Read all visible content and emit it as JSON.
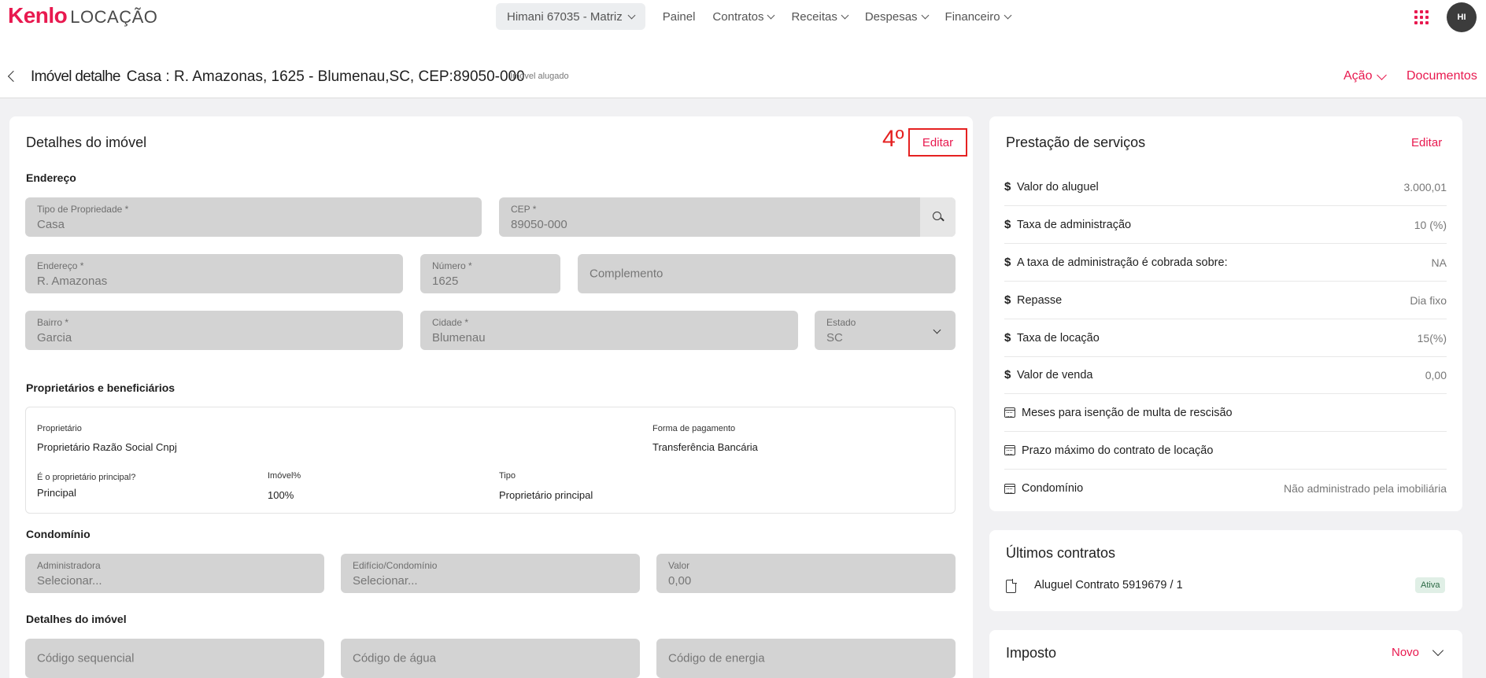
{
  "nav": {
    "brand": "Kenlo",
    "product": "LOCAÇÃO",
    "branch": "Himani 67035 - Matriz",
    "items": [
      "Painel",
      "Contratos",
      "Receitas",
      "Despesas",
      "Financeiro"
    ],
    "avatar_initials": "HI"
  },
  "header": {
    "title_prefix": "Imóvel detalhe",
    "title_address": "Casa : R. Amazonas, 1625 - Blumenau,SC, CEP:89050-000",
    "badge": "Imóvel alugado",
    "action": "Ação",
    "documents": "Documentos"
  },
  "details": {
    "title": "Detalhes do imóvel",
    "step_marker": "4º",
    "edit": "Editar",
    "address_section": "Endereço",
    "tipo": {
      "label": "Tipo de Propriedade *",
      "value": "Casa"
    },
    "cep": {
      "label": "CEP *",
      "value": "89050-000"
    },
    "endereco": {
      "label": "Endereço *",
      "value": "R. Amazonas"
    },
    "numero": {
      "label": "Número *",
      "value": "1625"
    },
    "complemento": {
      "placeholder": "Complemento"
    },
    "bairro": {
      "label": "Bairro *",
      "value": "Garcia"
    },
    "cidade": {
      "label": "Cidade *",
      "value": "Blumenau"
    },
    "estado": {
      "label": "Estado",
      "value": "SC"
    },
    "owners_section": "Proprietários e beneficiários",
    "owner": {
      "owner_label": "Proprietário",
      "owner_value": "Proprietário Razão Social Cnpj",
      "payment_label": "Forma de pagamento",
      "payment_value": "Transferência Bancária",
      "main_label": "É o proprietário principal?",
      "main_value": "Principal",
      "share_label": "Imóvel%",
      "share_value": "100%",
      "type_label": "Tipo",
      "type_value": "Proprietário principal"
    },
    "condo_section": "Condomínio",
    "administradora": {
      "label": "Administradora",
      "value": "Selecionar..."
    },
    "edificio": {
      "label": "Edifício/Condomínio",
      "value": "Selecionar..."
    },
    "valor": {
      "label": "Valor",
      "value": "0,00"
    },
    "details_section": "Detalhes do imóvel",
    "codigo_seq": {
      "placeholder": "Código sequencial"
    },
    "codigo_agua": {
      "placeholder": "Código de água"
    },
    "codigo_energia": {
      "placeholder": "Código de energia"
    }
  },
  "services": {
    "title": "Prestação de serviços",
    "edit": "Editar",
    "rows": [
      {
        "icon": "dollar-icon",
        "label": "Valor do aluguel",
        "value": "3.000,01"
      },
      {
        "icon": "dollar-icon",
        "label": "Taxa de administração",
        "value": "10 (%)"
      },
      {
        "icon": "dollar-icon",
        "label": "A taxa de administração é cobrada sobre:",
        "value": "NA"
      },
      {
        "icon": "dollar-icon",
        "label": "Repasse",
        "value": "Dia fixo"
      },
      {
        "icon": "dollar-icon",
        "label": "Taxa de locação",
        "value": "15(%)"
      },
      {
        "icon": "dollar-icon",
        "label": "Valor de venda",
        "value": "0,00"
      },
      {
        "icon": "calendar-icon",
        "label": "Meses para isenção de multa de rescisão",
        "value": ""
      },
      {
        "icon": "calendar-icon",
        "label": "Prazo máximo do contrato de locação",
        "value": ""
      },
      {
        "icon": "calendar-icon",
        "label": "Condomínio",
        "value": "Não administrado pela imobiliária"
      }
    ]
  },
  "contracts": {
    "title": "Últimos contratos",
    "item": "Aluguel Contrato 5919679 / 1",
    "status": "Ativa"
  },
  "tax": {
    "title": "Imposto",
    "new": "Novo"
  },
  "colors": {
    "accent": "#e8194f",
    "highlight": "#e52121",
    "field_bg": "#d3d3d3",
    "page_bg": "#f1f1f3"
  }
}
